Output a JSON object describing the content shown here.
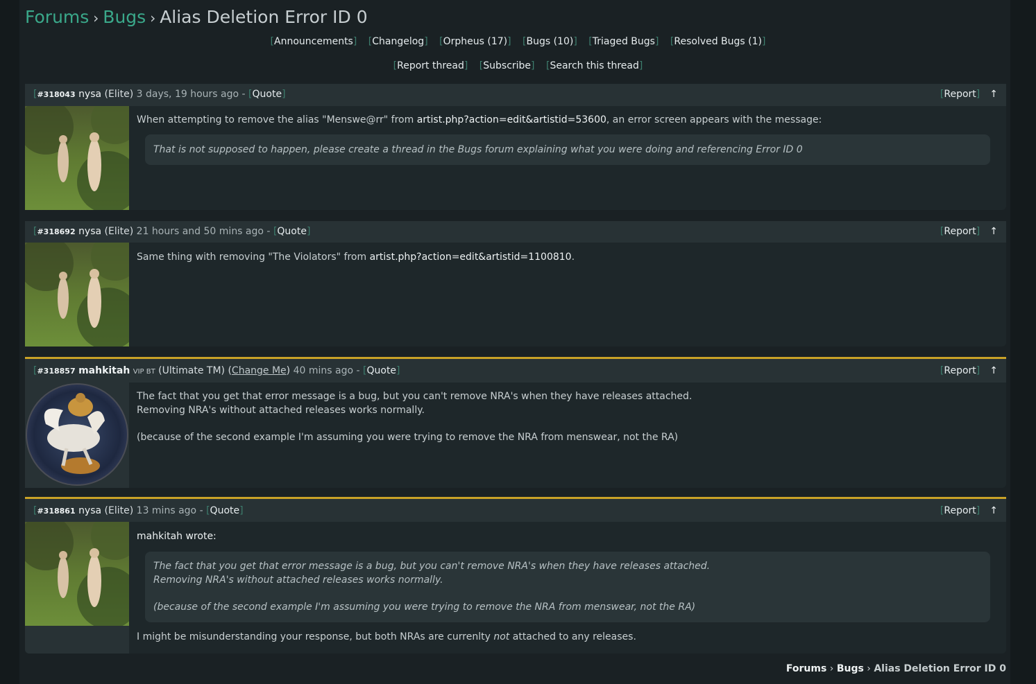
{
  "breadcrumb": {
    "forums": "Forums",
    "bugs": "Bugs",
    "sep": "›",
    "thread": "Alias Deletion Error ID 0"
  },
  "forum_links": [
    {
      "label": "Announcements"
    },
    {
      "label": "Changelog"
    },
    {
      "label": "Orpheus (17)"
    },
    {
      "label": "Bugs (10)"
    },
    {
      "label": "Triaged Bugs"
    },
    {
      "label": "Resolved Bugs (1)"
    }
  ],
  "thread_links": [
    {
      "label": "Report thread"
    },
    {
      "label": "Subscribe"
    },
    {
      "label": "Search this thread"
    }
  ],
  "common": {
    "quote": "Quote",
    "report": "Report",
    "up_arrow": "↑",
    "dash": "-"
  },
  "posts": [
    {
      "id": "#318043",
      "user": "nysa",
      "class": "(Elite)",
      "time": "3 days, 19 hours ago",
      "text_a": "When attempting to remove the alias \"Menswe@rr\" from ",
      "link": "artist.php?action=edit&artistid=53600",
      "text_b": ", an error screen appears with the message:",
      "quote": "That is not supposed to happen, please create a thread in the Bugs forum explaining what you were doing and referencing Error ID 0"
    },
    {
      "id": "#318692",
      "user": "nysa",
      "class": "(Elite)",
      "time": "21 hours and 50 mins ago",
      "text_a": "Same thing with removing \"The Violators\" from ",
      "link": "artist.php?action=edit&artistid=1100810",
      "text_b": "."
    },
    {
      "id": "#318857",
      "user": "mahkitah",
      "badges": "VIP BT",
      "class": "(Ultimate TM)",
      "change_me": "Change Me",
      "time": "40 mins ago",
      "line1": "The fact that you get that error message is a bug, but you can't remove NRA's when they have releases attached.",
      "line2": "Removing NRA's without attached releases works normally.",
      "line3": "(because of the second example I'm assuming you were trying to remove the NRA from menswear, not the RA)"
    },
    {
      "id": "#318861",
      "user": "nysa",
      "class": "(Elite)",
      "time": "13 mins ago",
      "quoted_user": "mahkitah",
      "wrote": "wrote:",
      "q1": "The fact that you get that error message is a bug, but you can't remove NRA's when they have releases attached.",
      "q2": "Removing NRA's without attached releases works normally.",
      "q3": "(because of the second example I'm assuming you were trying to remove the NRA from menswear, not the RA)",
      "reply_a": "I might be misunderstanding your response, but both NRAs are currenlty ",
      "reply_em": "not",
      "reply_b": " attached to any releases."
    }
  ]
}
